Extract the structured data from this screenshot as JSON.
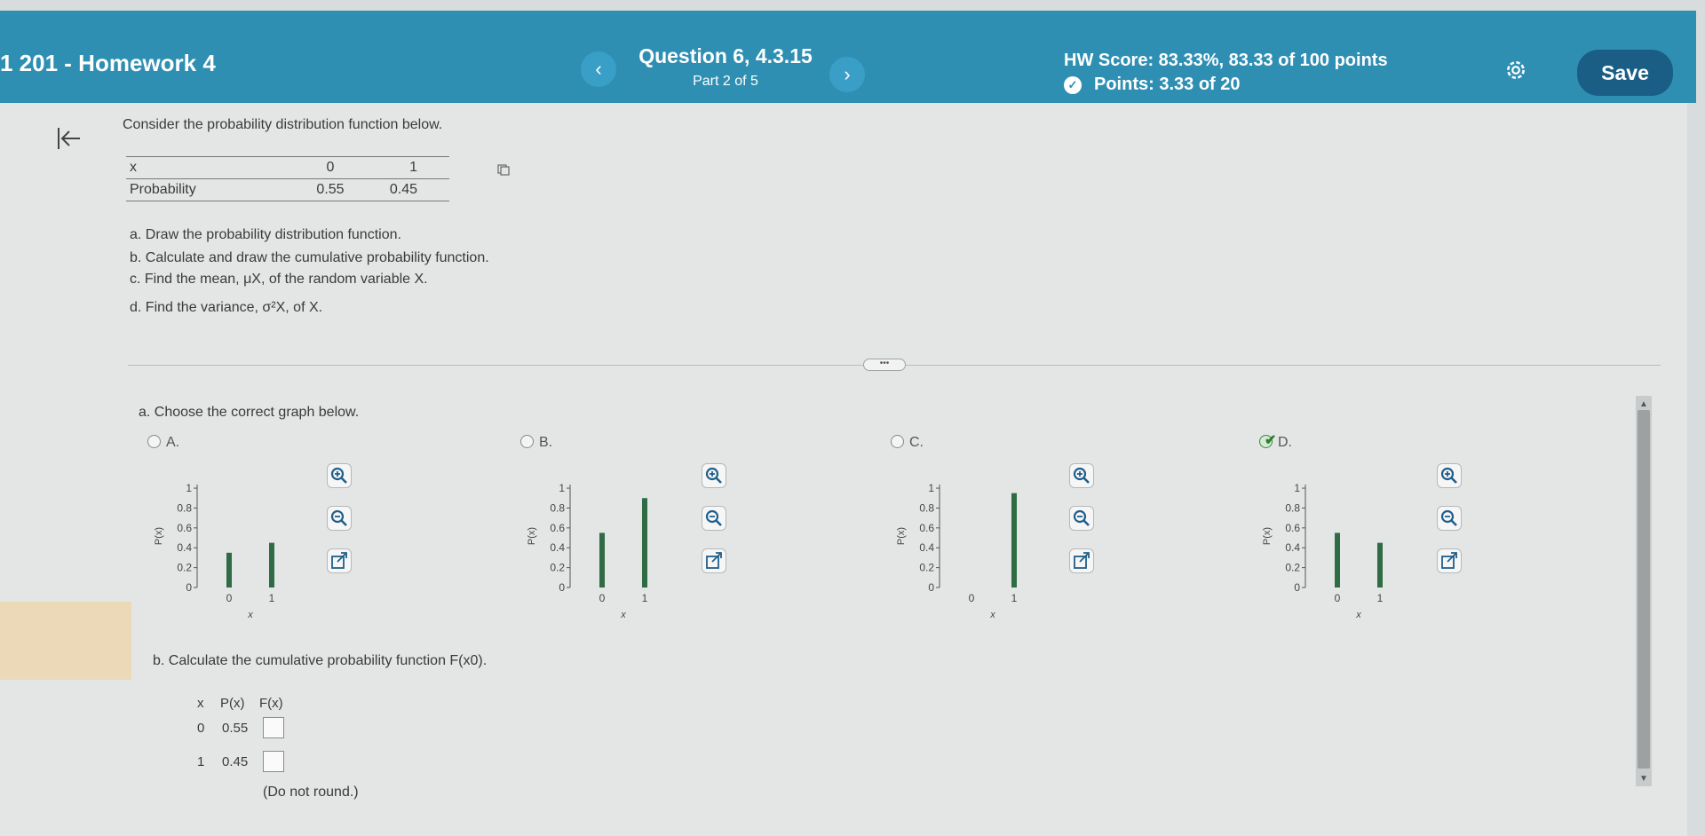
{
  "header": {
    "course_title": "1 201 - Homework 4",
    "question_title": "Question 6, 4.3.15",
    "question_part": "Part 2 of 5",
    "prev_label": "‹",
    "next_label": "›",
    "hw_score": "HW Score: 83.33%, 83.33 of 100 points",
    "points": "Points: 3.33 of 20",
    "save_label": "Save"
  },
  "problem": {
    "intro": "Consider the probability distribution function below.",
    "table": {
      "header_label": "x",
      "prob_label": "Probability",
      "x_values": [
        "0",
        "1"
      ],
      "probabilities": [
        "0.55",
        "0.45"
      ]
    },
    "parts": {
      "a": "a. Draw the probability distribution function.",
      "b": "b. Calculate and draw the cumulative probability function.",
      "c": "c. Find the mean, μX, of the random variable X.",
      "d": "d. Find the variance, σ²X, of X."
    },
    "more_label": "•••"
  },
  "question_a": {
    "prompt": "a. Choose the correct graph below.",
    "options": [
      {
        "label": "A.",
        "selected": false
      },
      {
        "label": "B.",
        "selected": false
      },
      {
        "label": "C.",
        "selected": false
      },
      {
        "label": "D.",
        "selected": true
      }
    ],
    "graph_axis": {
      "ylabel": "P(x)",
      "xlabel": "x",
      "y_ticks": [
        "1",
        "0.8",
        "0.6",
        "0.4",
        "0.2",
        "0"
      ],
      "x_ticks": [
        "0",
        "1"
      ]
    }
  },
  "chart_data": [
    {
      "type": "bar",
      "name_option": "A",
      "x": [
        0,
        1
      ],
      "values": [
        0.35,
        0.45
      ],
      "ylim": [
        0,
        1
      ],
      "xlabel": "x",
      "ylabel": "P(x)"
    },
    {
      "type": "bar",
      "name_option": "B",
      "x": [
        0,
        1
      ],
      "values": [
        0.55,
        0.9
      ],
      "ylim": [
        0,
        1
      ],
      "xlabel": "x",
      "ylabel": "P(x)"
    },
    {
      "type": "bar",
      "name_option": "C",
      "x": [
        0,
        1
      ],
      "values": [
        0,
        0.95
      ],
      "ylim": [
        0,
        1
      ],
      "xlabel": "x",
      "ylabel": "P(x)"
    },
    {
      "type": "bar",
      "name_option": "D",
      "x": [
        0,
        1
      ],
      "values": [
        0.55,
        0.45
      ],
      "ylim": [
        0,
        1
      ],
      "xlabel": "x",
      "ylabel": "P(x)"
    }
  ],
  "question_b": {
    "prompt": "b. Calculate the cumulative probability function F(x0).",
    "headers": [
      "x",
      "P(x)",
      "F(x)"
    ],
    "rows": [
      {
        "x": "0",
        "p": "0.55",
        "f": ""
      },
      {
        "x": "1",
        "p": "0.45",
        "f": ""
      }
    ],
    "note": "(Do not round.)"
  },
  "colors": {
    "header_bg": "#2e8fb3",
    "save_bg": "#1a5e86",
    "bar_color": "#2f6b45",
    "correct_check": "#2e7d32"
  },
  "icons": [
    "collapse-left-icon",
    "gear-icon",
    "copy-icon",
    "zoom-in-icon",
    "zoom-out-icon",
    "open-external-icon",
    "points-check-icon"
  ]
}
